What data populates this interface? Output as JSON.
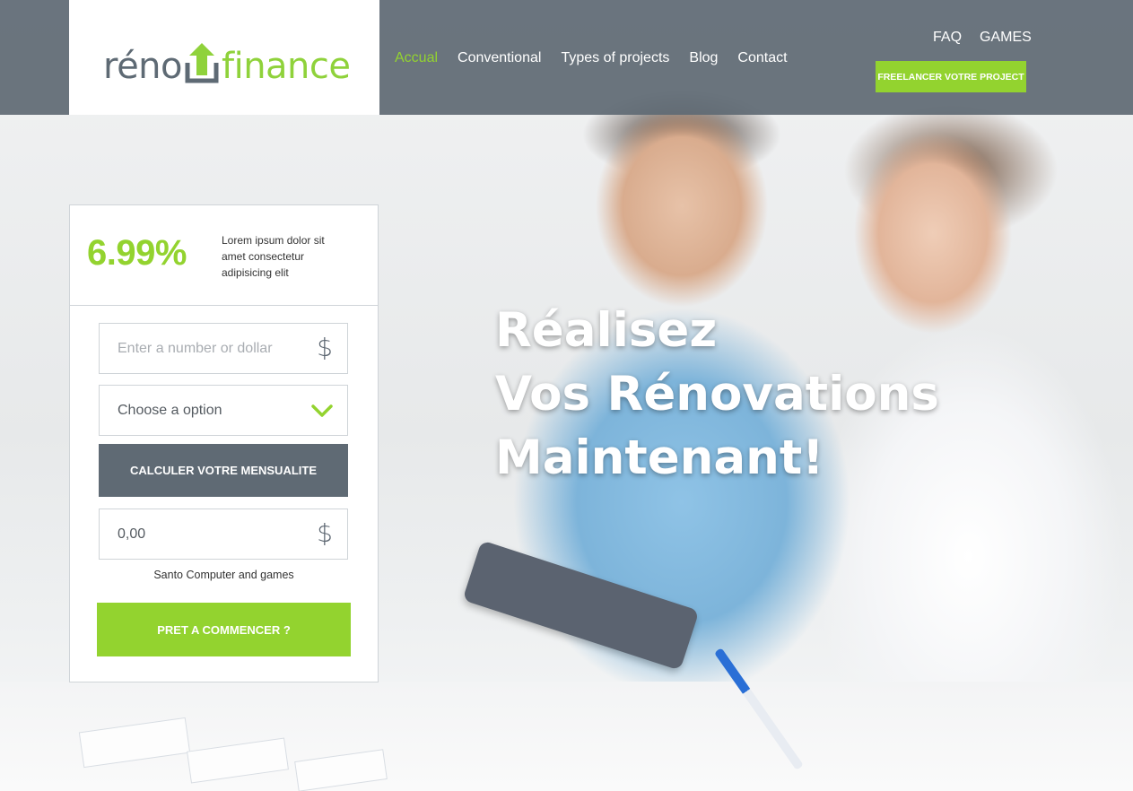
{
  "brand": {
    "logo_text_left": "réno",
    "logo_text_right": "finance",
    "logo_icon": "house-arrow-icon",
    "colors": {
      "accent": "#93d32f",
      "header": "#606a74",
      "logo_gray": "#5e6a74"
    }
  },
  "nav": {
    "items": [
      {
        "label": "Accual",
        "active": true
      },
      {
        "label": "Conventional",
        "active": false
      },
      {
        "label": "Types of projects",
        "active": false
      },
      {
        "label": "Blog",
        "active": false
      },
      {
        "label": "Contact",
        "active": false
      }
    ]
  },
  "top_links": {
    "faq": "FAQ",
    "games": "GAMES"
  },
  "header_cta": "FREELANCER VOTRE PROJECT",
  "calculator": {
    "rate": "6.99%",
    "rate_description": "Lorem ipsum dolor sit amet consectetur adipisicing elit",
    "amount_placeholder": "Enter a number or dollar",
    "currency_symbol": "$",
    "select_value": "Choose a option",
    "calc_button": "CALCULER VOTRE MENSUALITE",
    "result_value": "0,00",
    "note": "Santo Computer and games",
    "start_button": "PRET A COMMENCER ?"
  },
  "hero": {
    "line1": "Réalisez",
    "line2": "Vos Rénovations",
    "line3": "Maintenant!"
  }
}
